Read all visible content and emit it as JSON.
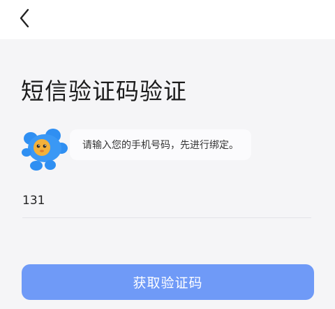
{
  "header": {
    "back_icon": "chevron-left-icon"
  },
  "page": {
    "title": "短信验证码验证"
  },
  "tip": {
    "mascot_icon": "blue-mascot-icon",
    "text": "请输入您的手机号码，先进行绑定。"
  },
  "phone": {
    "value": "131"
  },
  "actions": {
    "get_code_label": "获取验证码"
  },
  "colors": {
    "primary_button": "#6f9af7",
    "mascot_body": "#2f8ff2",
    "mascot_face": "#f3b13a"
  }
}
